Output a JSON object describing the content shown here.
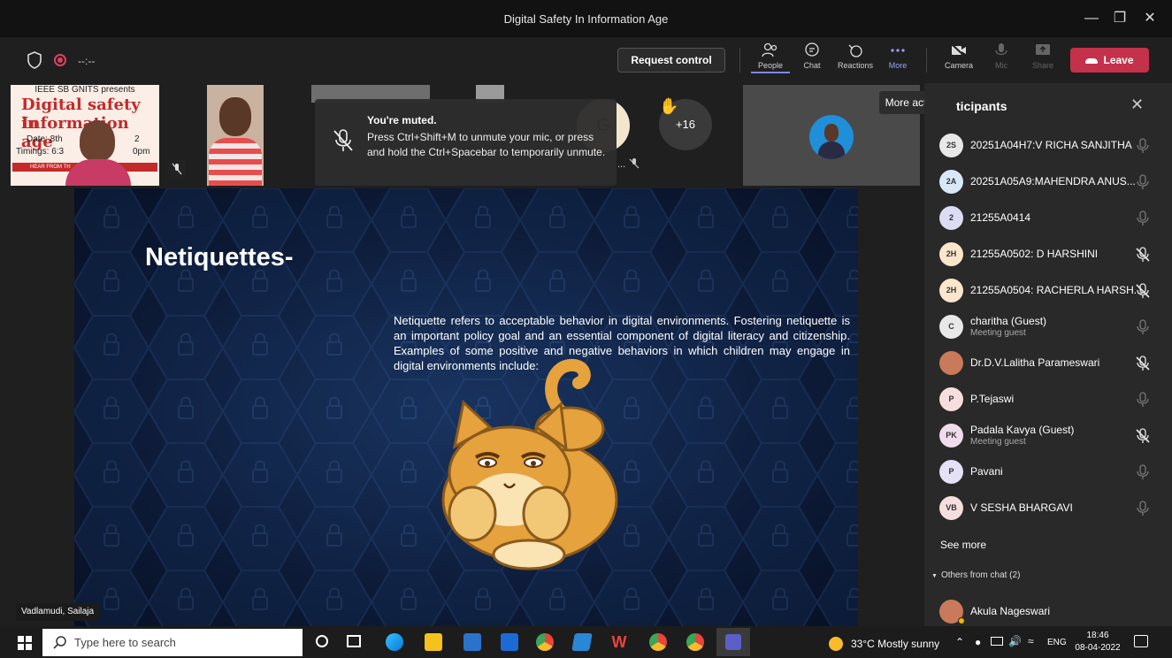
{
  "window": {
    "title": "Digital Safety In Information Age"
  },
  "toolbar": {
    "timer": "--:--",
    "request_control": "Request control",
    "people": "People",
    "chat": "Chat",
    "reactions": "Reactions",
    "more": "More",
    "camera": "Camera",
    "mic": "Mic",
    "share": "Share",
    "leave": "Leave"
  },
  "tooltip": "More actions",
  "toast": {
    "title": "You're muted.",
    "body": "Press Ctrl+Shift+M to unmute your mic, or press and hold the Ctrl+Spacebar to temporarily unmute."
  },
  "thumbnails": {
    "poster_line1": "IEEE SB GNITS presents",
    "poster_line2": "Digital safety in",
    "poster_line3": "Information age",
    "poster_date": "Date: 8th",
    "poster_date_end": "2",
    "poster_timing": "Timings: 6:3",
    "poster_timing_end": "0pm",
    "poster_banner": "HEAR FROM TH",
    "overflow_count": "+16",
    "initials_partial": "G",
    "name_partial": "..."
  },
  "slide": {
    "title": "Netiquettes-",
    "body": "Netiquette refers to acceptable behavior in digital environments. Fostering netiquette is an important policy goal and an essential component of digital literacy and citizenship. Examples of some positive and negative behaviors in which children may engage in digital environments include:"
  },
  "presenter_name": "Vadlamudi, Sailaja",
  "panel": {
    "title": "ticipants",
    "participants": [
      {
        "initials": "2S",
        "name": "20251A04H7:V RICHA SANJITHA",
        "sub": "",
        "muted": false,
        "avatar_color": "#e8e8e8"
      },
      {
        "initials": "2A",
        "name": "20251A05A9:MAHENDRA ANUS...",
        "sub": "",
        "muted": false,
        "avatar_color": "#d9e8f7"
      },
      {
        "initials": "2",
        "name": "21255A0414",
        "sub": "",
        "muted": false,
        "avatar_color": "#dcdcf5"
      },
      {
        "initials": "2H",
        "name": "21255A0502: D HARSHINI",
        "sub": "",
        "muted": true,
        "avatar_color": "#fbe6cc"
      },
      {
        "initials": "2H",
        "name": "21255A0504: RACHERLA HARSH...",
        "sub": "",
        "muted": true,
        "avatar_color": "#fbe6cc"
      },
      {
        "initials": "C",
        "name": "charitha (Guest)",
        "sub": "Meeting guest",
        "muted": false,
        "avatar_color": "#e8e8e8"
      },
      {
        "initials": "",
        "name": "Dr.D.V.Lalitha Parameswari",
        "sub": "",
        "muted": true,
        "avatar_color": "#c97a5a"
      },
      {
        "initials": "P",
        "name": "P.Tejaswi",
        "sub": "",
        "muted": false,
        "avatar_color": "#f7dede"
      },
      {
        "initials": "PK",
        "name": "Padala Kavya (Guest)",
        "sub": "Meeting guest",
        "muted": true,
        "avatar_color": "#f0dcec"
      },
      {
        "initials": "P",
        "name": "Pavani",
        "sub": "",
        "muted": false,
        "avatar_color": "#e5e1f7"
      },
      {
        "initials": "VB",
        "name": "V SESHA BHARGAVI",
        "sub": "",
        "muted": false,
        "avatar_color": "#f7dede"
      }
    ],
    "see_more": "See more",
    "others": "Others from chat (2)",
    "chat_person": "Akula Nageswari"
  },
  "taskbar": {
    "search_placeholder": "Type here to search",
    "weather": "33°C  Mostly sunny",
    "lang": "ENG",
    "time": "18:46",
    "date": "08-04-2022"
  },
  "colors": {
    "leave": "#c4314b",
    "accent": "#7f85f5"
  }
}
